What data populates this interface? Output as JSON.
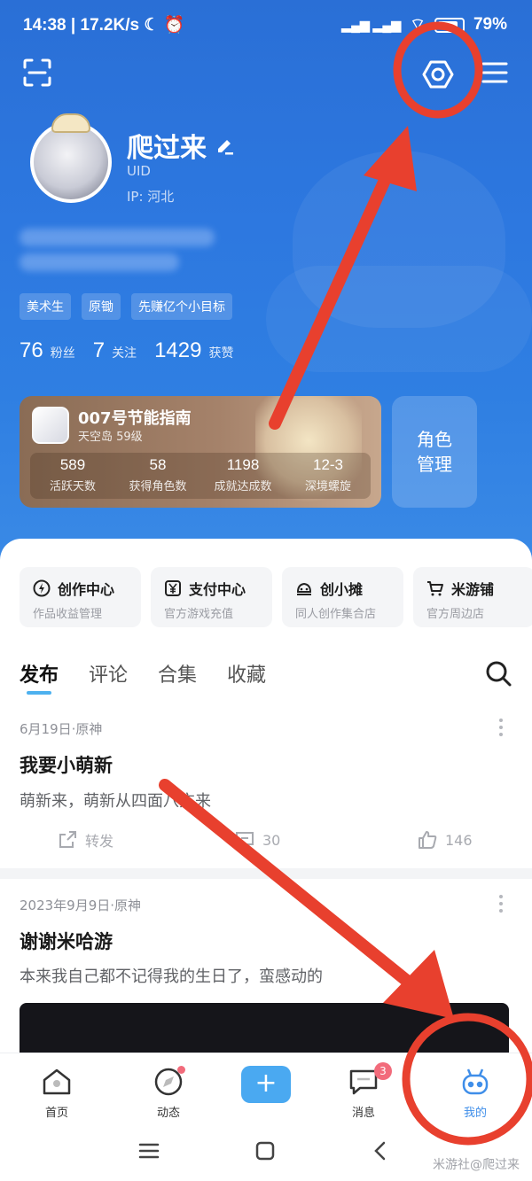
{
  "status_bar": {
    "time": "14:38",
    "net_speed": "17.2K/s",
    "battery": "79%"
  },
  "profile": {
    "name": "爬过来",
    "uid_label": "UID",
    "ip": "IP: 河北",
    "tags": [
      "美术生",
      "原锄",
      "先赚亿个小目标"
    ],
    "stats": [
      {
        "value": "76",
        "label": "粉丝"
      },
      {
        "value": "7",
        "label": "关注"
      },
      {
        "value": "1429",
        "label": "获赞"
      }
    ]
  },
  "game_card": {
    "title": "007号节能指南",
    "server": "天空岛 59级",
    "logo_text": "",
    "stats": [
      {
        "value": "589",
        "label": "活跃天数"
      },
      {
        "value": "58",
        "label": "获得角色数"
      },
      {
        "value": "1198",
        "label": "成就达成数"
      },
      {
        "value": "12-3",
        "label": "深境螺旋"
      }
    ]
  },
  "role_button": {
    "line1": "角色",
    "line2": "管理"
  },
  "shortcuts": [
    {
      "title": "创作中心",
      "subtitle": "作品收益管理",
      "icon": "creation-icon"
    },
    {
      "title": "支付中心",
      "subtitle": "官方游戏充值",
      "icon": "yen-icon"
    },
    {
      "title": "创小摊",
      "subtitle": "同人创作集合店",
      "icon": "stall-icon"
    },
    {
      "title": "米游铺",
      "subtitle": "官方周边店",
      "icon": "cart-icon"
    }
  ],
  "tabs": [
    "发布",
    "评论",
    "合集",
    "收藏"
  ],
  "posts": [
    {
      "meta": "6月19日·原神",
      "title": "我要小萌新",
      "body": "萌新来，萌新从四面八方来",
      "share_label": "转发",
      "comments": "30",
      "likes": "146"
    },
    {
      "meta": "2023年9月9日·原神",
      "title": "谢谢米哈游",
      "body": "本来我自己都不记得我的生日了，蛮感动的"
    }
  ],
  "bottom_nav": {
    "home": "首页",
    "feed": "动态",
    "messages": "消息",
    "messages_badge": "3",
    "me": "我的"
  },
  "watermark": "米游社@爬过来",
  "colors": {
    "hero_blue": "#2d78e0",
    "accent": "#4aa9f1",
    "annotation_red": "#e8402e"
  }
}
